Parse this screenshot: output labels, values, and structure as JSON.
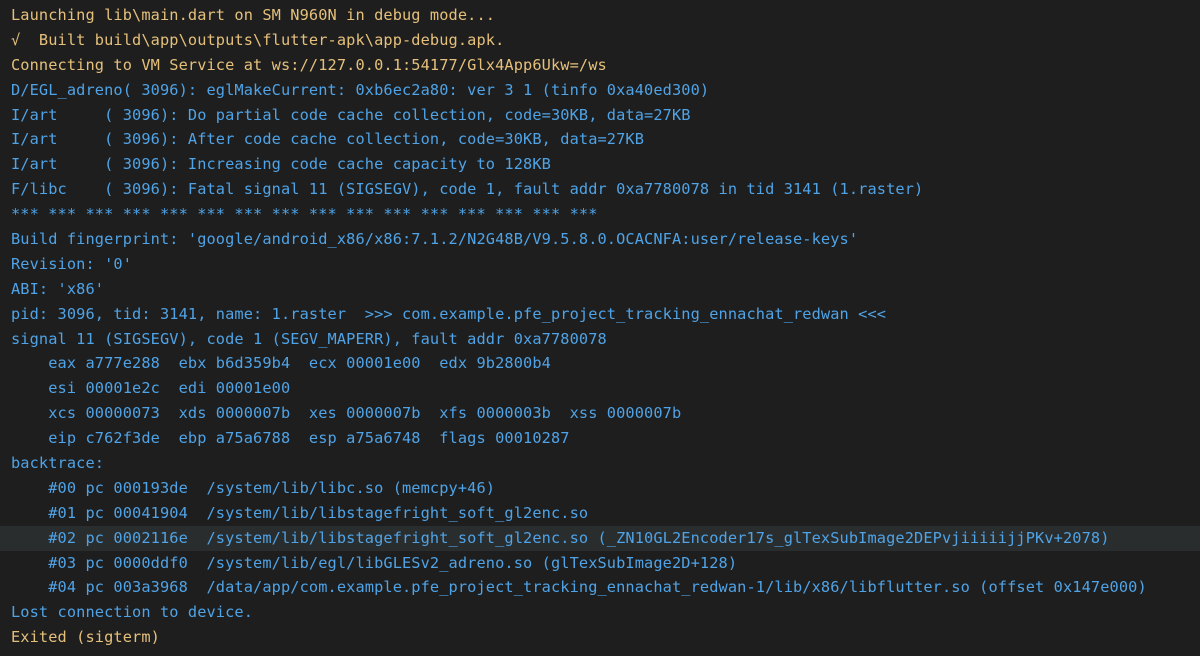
{
  "colors": {
    "background": "#1e1e1e",
    "yellow": "#e5c07b",
    "blue": "#4fa3e6",
    "highlight": "#2a2d2e"
  },
  "console": {
    "lines": [
      {
        "text": "Launching lib\\main.dart on SM N960N in debug mode...",
        "color": "yellow"
      },
      {
        "text": "√  Built build\\app\\outputs\\flutter-apk\\app-debug.apk.",
        "color": "yellow"
      },
      {
        "text": "Connecting to VM Service at ws://127.0.0.1:54177/Glx4App6Ukw=/ws",
        "color": "yellow"
      },
      {
        "text": "D/EGL_adreno( 3096): eglMakeCurrent: 0xb6ec2a80: ver 3 1 (tinfo 0xa40ed300)",
        "color": "blue"
      },
      {
        "text": "I/art     ( 3096): Do partial code cache collection, code=30KB, data=27KB",
        "color": "blue"
      },
      {
        "text": "I/art     ( 3096): After code cache collection, code=30KB, data=27KB",
        "color": "blue"
      },
      {
        "text": "I/art     ( 3096): Increasing code cache capacity to 128KB",
        "color": "blue"
      },
      {
        "text": "F/libc    ( 3096): Fatal signal 11 (SIGSEGV), code 1, fault addr 0xa7780078 in tid 3141 (1.raster)",
        "color": "blue"
      },
      {
        "text": "*** *** *** *** *** *** *** *** *** *** *** *** *** *** *** ***",
        "color": "blue"
      },
      {
        "text": "Build fingerprint: 'google/android_x86/x86:7.1.2/N2G48B/V9.5.8.0.OCACNFA:user/release-keys'",
        "color": "blue"
      },
      {
        "text": "Revision: '0'",
        "color": "blue"
      },
      {
        "text": "ABI: 'x86'",
        "color": "blue"
      },
      {
        "text": "pid: 3096, tid: 3141, name: 1.raster  >>> com.example.pfe_project_tracking_ennachat_redwan <<<",
        "color": "blue"
      },
      {
        "text": "signal 11 (SIGSEGV), code 1 (SEGV_MAPERR), fault addr 0xa7780078",
        "color": "blue"
      },
      {
        "text": "    eax a777e288  ebx b6d359b4  ecx 00001e00  edx 9b2800b4",
        "color": "blue"
      },
      {
        "text": "    esi 00001e2c  edi 00001e00",
        "color": "blue"
      },
      {
        "text": "    xcs 00000073  xds 0000007b  xes 0000007b  xfs 0000003b  xss 0000007b",
        "color": "blue"
      },
      {
        "text": "    eip c762f3de  ebp a75a6788  esp a75a6748  flags 00010287",
        "color": "blue"
      },
      {
        "text": "backtrace:",
        "color": "blue"
      },
      {
        "text": "    #00 pc 000193de  /system/lib/libc.so (memcpy+46)",
        "color": "blue"
      },
      {
        "text": "    #01 pc 00041904  /system/lib/libstagefright_soft_gl2enc.so",
        "color": "blue"
      },
      {
        "text": "    #02 pc 0002116e  /system/lib/libstagefright_soft_gl2enc.so (_ZN10GL2Encoder17s_glTexSubImage2DEPvjiiiiijjPKv+2078)",
        "color": "blue",
        "highlighted": true
      },
      {
        "text": "    #03 pc 0000ddf0  /system/lib/egl/libGLESv2_adreno.so (glTexSubImage2D+128)",
        "color": "blue"
      },
      {
        "text": "    #04 pc 003a3968  /data/app/com.example.pfe_project_tracking_ennachat_redwan-1/lib/x86/libflutter.so (offset 0x147e000)",
        "color": "blue"
      },
      {
        "text": "Lost connection to device.",
        "color": "blue"
      },
      {
        "text": "Exited (sigterm)",
        "color": "yellow"
      }
    ]
  }
}
